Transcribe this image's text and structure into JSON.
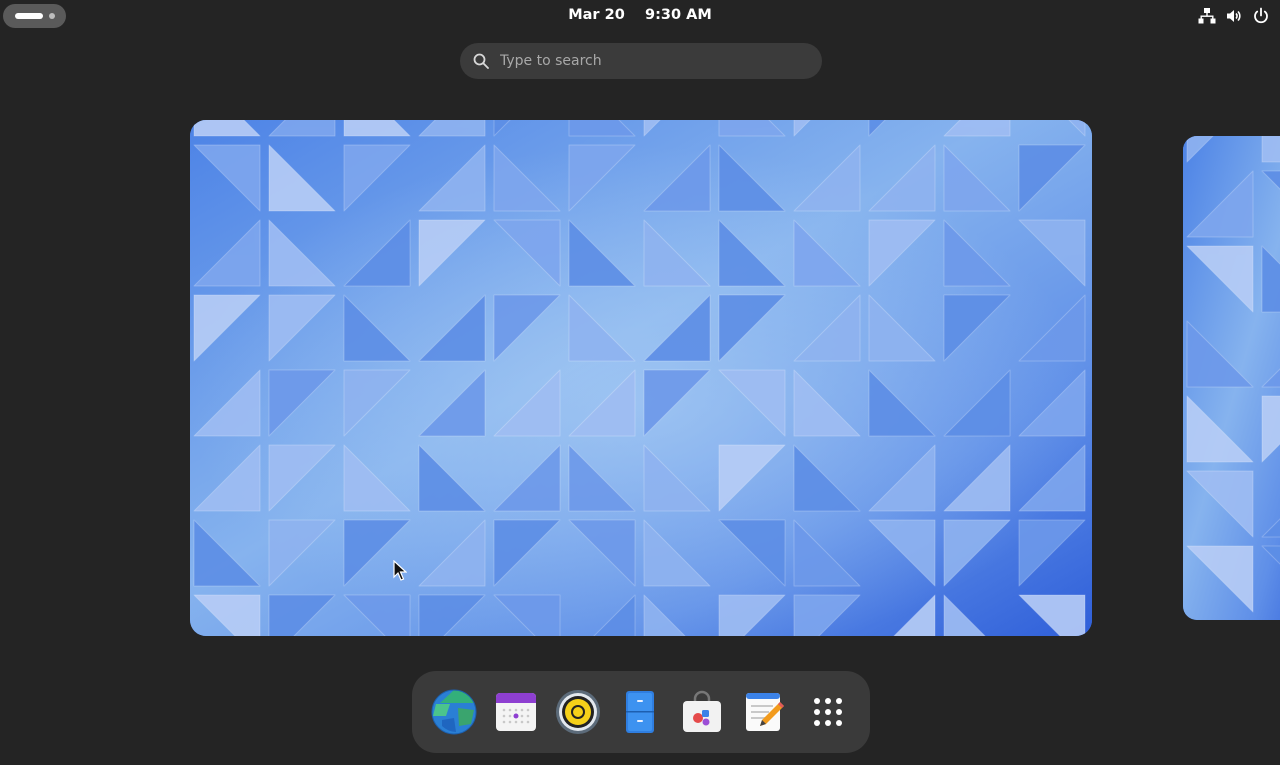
{
  "topbar": {
    "date": "Mar 20",
    "time": "9:30 AM",
    "activities_icon": "activities-indicator",
    "tray_icons": [
      "network-wired-icon",
      "volume-icon",
      "power-icon"
    ]
  },
  "search": {
    "placeholder": "Type to search",
    "value": "",
    "icon": "search-icon"
  },
  "workspaces": [
    {
      "name": "workspace-1",
      "wallpaper": "blue-triangles",
      "active": true
    },
    {
      "name": "workspace-2",
      "wallpaper": "blue-triangles",
      "active": false
    }
  ],
  "dock": {
    "apps": [
      {
        "name": "Web Browser",
        "icon": "globe-icon"
      },
      {
        "name": "Calendar",
        "icon": "calendar-icon"
      },
      {
        "name": "Rhythmbox",
        "icon": "speaker-icon"
      },
      {
        "name": "Files",
        "icon": "file-cabinet-icon"
      },
      {
        "name": "Software",
        "icon": "software-bag-icon"
      },
      {
        "name": "Text Editor",
        "icon": "text-editor-icon"
      },
      {
        "name": "Show Apps",
        "icon": "app-grid-icon"
      }
    ]
  },
  "colors": {
    "background": "#242424",
    "panel": "#3a3a3a",
    "search_bg": "#3b3b3b",
    "wallpaper_primary": "#4a7ce0",
    "wallpaper_light": "#a8c2f3"
  }
}
